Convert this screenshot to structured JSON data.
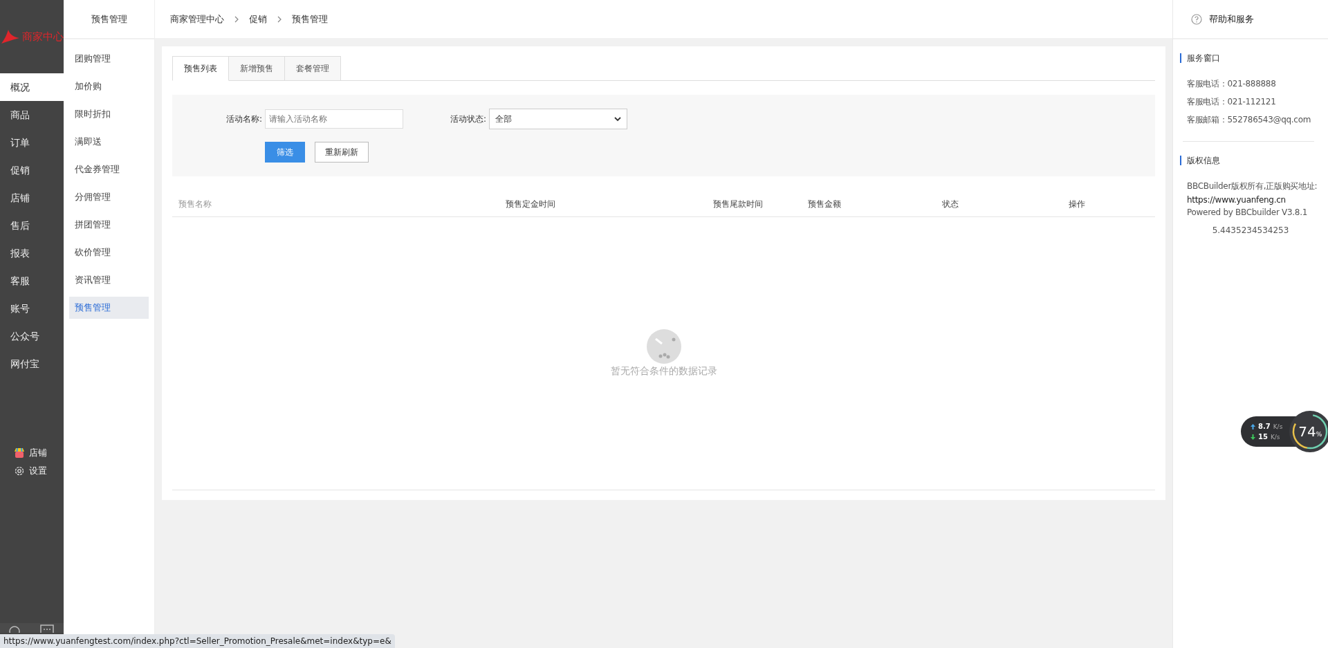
{
  "logo": {
    "text": "商家中心"
  },
  "main_nav": [
    {
      "label": "概况",
      "selected": true
    },
    {
      "label": "商品",
      "selected": false
    },
    {
      "label": "订单",
      "selected": false
    },
    {
      "label": "促销",
      "selected": false
    },
    {
      "label": "店铺",
      "selected": false
    },
    {
      "label": "售后",
      "selected": false
    },
    {
      "label": "报表",
      "selected": false
    },
    {
      "label": "客服",
      "selected": false
    },
    {
      "label": "账号",
      "selected": false
    },
    {
      "label": "公众号",
      "selected": false
    },
    {
      "label": "网付宝",
      "selected": false
    }
  ],
  "nav_links": [
    {
      "kind": "shop",
      "label": "店铺"
    },
    {
      "kind": "settings",
      "label": "设置"
    }
  ],
  "submenu": {
    "title": "预售管理",
    "items": [
      {
        "label": "团购管理",
        "selected": false
      },
      {
        "label": "加价购",
        "selected": false
      },
      {
        "label": "限时折扣",
        "selected": false
      },
      {
        "label": "满即送",
        "selected": false
      },
      {
        "label": "代金券管理",
        "selected": false
      },
      {
        "label": "分佣管理",
        "selected": false
      },
      {
        "label": "拼团管理",
        "selected": false
      },
      {
        "label": "砍价管理",
        "selected": false
      },
      {
        "label": "资讯管理",
        "selected": false
      },
      {
        "label": "预售管理",
        "selected": true
      }
    ]
  },
  "breadcrumb": [
    "商家管理中心",
    "促销",
    "预售管理"
  ],
  "tabs": [
    {
      "label": "预售列表",
      "selected": true
    },
    {
      "label": "新增预售",
      "selected": false
    },
    {
      "label": "套餐管理",
      "selected": false
    }
  ],
  "filter": {
    "name_label": "活动名称:",
    "name_placeholder": "请输入活动名称",
    "status_label": "活动状态:",
    "status_value": "全部",
    "filter_button": "筛选",
    "refresh_button": "重新刷新"
  },
  "table": {
    "columns": [
      "预售名称",
      "预售定金时间",
      "预售尾款时间",
      "预售金额",
      "状态",
      "操作"
    ],
    "empty_text": "暂无符合条件的数据记录"
  },
  "help": {
    "title": "帮助和服务",
    "service_title": "服务窗口",
    "service_lines": [
      "客服电话：021-888888",
      "客服电话：021-112121",
      "客服邮箱：552786543@qq.com"
    ],
    "copyright_title": "版权信息",
    "copyright_lines": [
      "BBCBuilder版权所有,正版购买地址:",
      "https://www.yuanfeng.cn",
      "Powered by BBCbuilder V3.8.1"
    ],
    "version": "5.4435234534253"
  },
  "speed_widget": {
    "upload": "8.7",
    "upload_unit": "K/s",
    "download": "15",
    "download_unit": "K/s",
    "percent": "74",
    "percent_sign": "%"
  },
  "status_bar": {
    "url": "https://www.yuanfengtest.com/index.php?ctl=Seller_Promotion_Presale&met=index&typ=e&"
  }
}
